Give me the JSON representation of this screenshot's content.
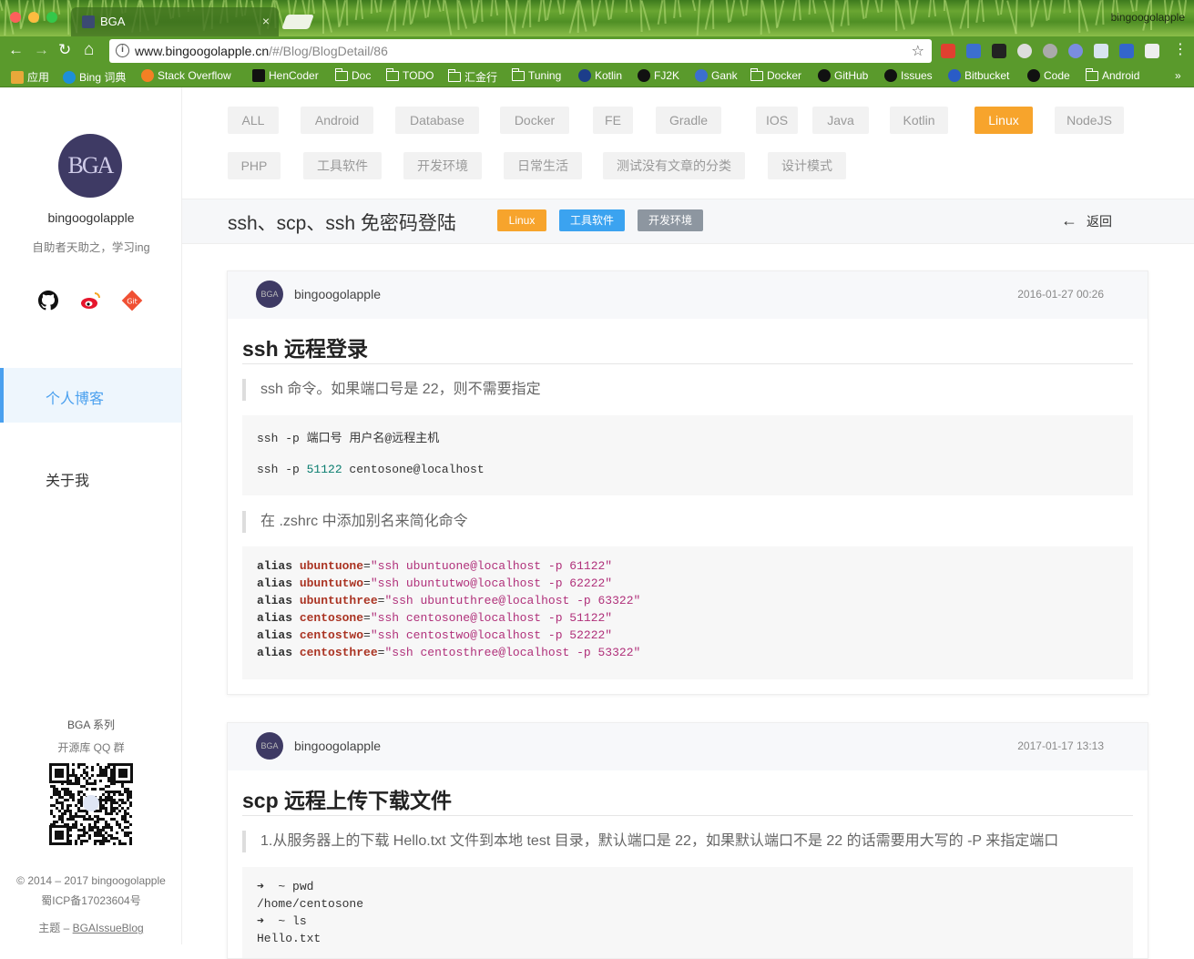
{
  "browser": {
    "tab_title": "BGA",
    "tab_close": "×",
    "profile_name": "bingoogolapple",
    "url_host": "www.bingoogolapple.cn",
    "url_path": "/#/Blog/BlogDetail/86",
    "star": "☆",
    "nav": {
      "back": "←",
      "forward": "→",
      "reload": "↻",
      "home": "⌂"
    }
  },
  "bookmarks": [
    {
      "label": "应用",
      "icon": "apps-icon"
    },
    {
      "label": "Bing 词典",
      "icon": "bing-icon"
    },
    {
      "label": "Stack Overflow",
      "icon": "stackoverflow-icon"
    },
    {
      "label": "HenCoder",
      "icon": "hencoder-icon"
    },
    {
      "label": "Doc",
      "icon": "folder-icon"
    },
    {
      "label": "TODO",
      "icon": "folder-icon"
    },
    {
      "label": "汇金行",
      "icon": "folder-icon"
    },
    {
      "label": "Tuning",
      "icon": "folder-icon"
    },
    {
      "label": "Kotlin",
      "icon": "kotlin-icon"
    },
    {
      "label": "FJ2K",
      "icon": "github-icon"
    },
    {
      "label": "Gank",
      "icon": "gank-icon"
    },
    {
      "label": "Docker",
      "icon": "folder-icon"
    },
    {
      "label": "GitHub",
      "icon": "github-icon"
    },
    {
      "label": "Issues",
      "icon": "github-icon"
    },
    {
      "label": "Bitbucket",
      "icon": "bitbucket-icon"
    },
    {
      "label": "Code",
      "icon": "github-icon"
    },
    {
      "label": "Android",
      "icon": "folder-icon"
    }
  ],
  "bookmarks_more": "»",
  "sidebar": {
    "avatar_text": "BGA",
    "username": "bingoogolapple",
    "motto": "自助者天助之，学习ing",
    "nav_blog": "个人博客",
    "nav_about": "关于我",
    "series": "BGA 系列",
    "qq_group": "开源库 QQ 群",
    "copyright": "© 2014 – 2017 bingoogolapple",
    "icp": "蜀ICP备17023604号",
    "theme_prefix": "主题 – ",
    "theme_link": "BGAIssueBlog"
  },
  "tags": [
    "ALL",
    "Android",
    "Database",
    "Docker",
    "FE",
    "Gradle",
    "IOS",
    "Java",
    "Kotlin",
    "Linux",
    "NodeJS",
    "PHP",
    "工具软件",
    "开发环境",
    "日常生活",
    "测试没有文章的分类",
    "设计模式"
  ],
  "active_tag": "Linux",
  "post": {
    "title": "ssh、scp、ssh 免密码登陆",
    "badges": [
      {
        "label": "Linux",
        "color": "#f7a42c"
      },
      {
        "label": "工具软件",
        "color": "#3ba3f0"
      },
      {
        "label": "开发环境",
        "color": "#8d96a0"
      }
    ],
    "back_label": "返回",
    "back_arrow": "←"
  },
  "cards": [
    {
      "author": "bingoogolapple",
      "avatar_text": "BGA",
      "date": "2016-01-27 00:26",
      "heading": "ssh 远程登录",
      "quote1": "ssh 命令。如果端口号是 22，则不需要指定",
      "code1": {
        "line1": "ssh -p 端口号 用户名@远程主机",
        "line3_cmd": "ssh -p ",
        "line3_num": "51122",
        "line3_rest": " centosone@localhost"
      },
      "quote2": "在 .zshrc 中添加别名来简化命令",
      "aliases": [
        {
          "kw": "alias",
          "name": "ubuntuone",
          "eq": "=",
          "str": "\"ssh ubuntuone@localhost -p 61122\""
        },
        {
          "kw": "alias",
          "name": "ubuntutwo",
          "eq": "=",
          "str": "\"ssh ubuntutwo@localhost -p 62222\""
        },
        {
          "kw": "alias",
          "name": "ubuntuthree",
          "eq": "=",
          "str": "\"ssh ubuntuthree@localhost -p 63322\""
        },
        {
          "kw": "alias",
          "name": "centosone",
          "eq": "=",
          "str": "\"ssh centosone@localhost -p 51122\""
        },
        {
          "kw": "alias",
          "name": "centostwo",
          "eq": "=",
          "str": "\"ssh centostwo@localhost -p 52222\""
        },
        {
          "kw": "alias",
          "name": "centosthree",
          "eq": "=",
          "str": "\"ssh centosthree@localhost -p 53322\""
        }
      ]
    },
    {
      "author": "bingoogolapple",
      "avatar_text": "BGA",
      "date": "2017-01-17 13:13",
      "heading": "scp 远程上传下载文件",
      "quote1": "1.从服务器上的下载 Hello.txt 文件到本地 test 目录，默认端口是 22，如果默认端口不是 22 的话需要用大写的 -P 来指定端口",
      "code_lines": [
        "➜  ~ pwd",
        "/home/centosone",
        "➜  ~ ls",
        "Hello.txt"
      ]
    }
  ],
  "colors": {
    "accent": "#4aa0ef",
    "active_tag": "#f7a42c",
    "chrome_green": "#5a9a2c"
  }
}
